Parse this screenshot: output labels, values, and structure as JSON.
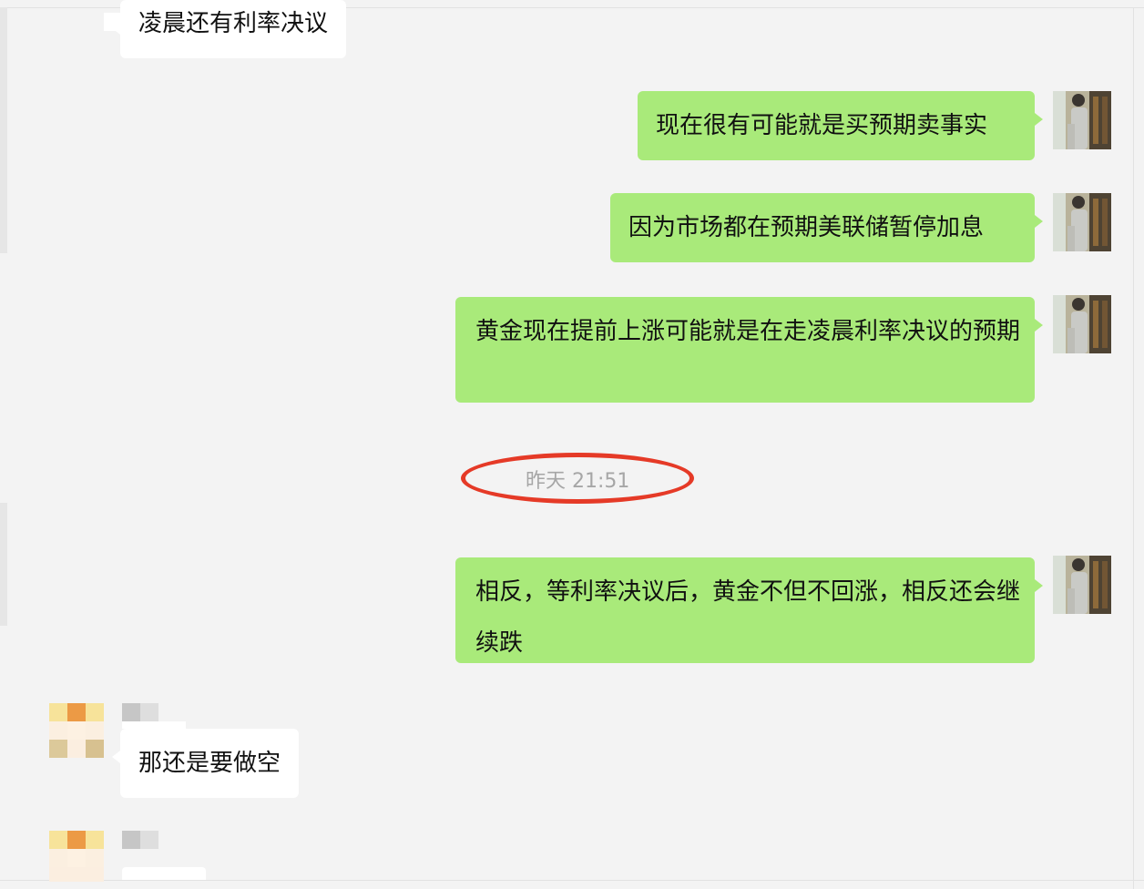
{
  "messages": [
    {
      "side": "other",
      "text": "凌晨还有利率决议"
    },
    {
      "side": "me",
      "text": "现在很有可能就是买预期卖事实"
    },
    {
      "side": "me",
      "text": "因为市场都在预期美联储暂停加息"
    },
    {
      "side": "me",
      "text": "黄金现在提前上涨可能就是在走凌晨利率决议的预期"
    },
    {
      "side": "me",
      "text": "相反，等利率决议后，黄金不但不回涨，相反还会继续跌"
    },
    {
      "side": "other",
      "text": "那还是要做空"
    }
  ],
  "timestamp": "昨天 21:51",
  "annotation": {
    "shape": "oval",
    "color": "#e53a27",
    "target": "timestamp"
  },
  "colors": {
    "background": "#f3f3f3",
    "my_bubble": "#a9ea7a",
    "other_bubble": "#ffffff",
    "timestamp_text": "#a6a6a6"
  }
}
